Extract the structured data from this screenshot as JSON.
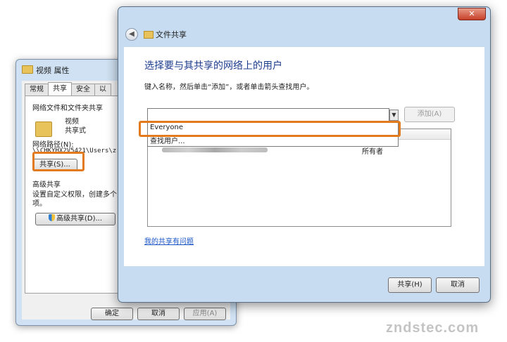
{
  "props": {
    "title": "视频 属性",
    "tabs": [
      "常规",
      "共享",
      "安全",
      "以"
    ],
    "section1": "网络文件和文件夹共享",
    "folder_name": "视频",
    "folder_state": "共享式",
    "path_label": "网络路径(N):",
    "path_value": "\\\\CHKYHX2V5421\\Users\\z",
    "share_button": "共享(S)...",
    "section2": "高级共享",
    "adv_desc_1": "设置自定义权限，创建多个",
    "adv_desc_2": "项。",
    "adv_button": "高级共享(D)...",
    "ok_button": "确定",
    "cancel_button": "取消",
    "apply_button": "应用(A)"
  },
  "share": {
    "close_glyph": "✕",
    "back_glyph": "◀",
    "title": "文件共享",
    "heading": "选择要与其共享的网络上的用户",
    "instruction": "键入名称，然后单击“添加”，或者单击箭头查找用户。",
    "dropdown_glyph": "▼",
    "add_button": "添加(A)",
    "dropdown_items": [
      "Everyone",
      "查找用户..."
    ],
    "row_permission": "所有者",
    "help_link": "我的共享有问题",
    "share_button": "共享(H)",
    "cancel_button": "取消"
  },
  "watermark": "zndstec.com"
}
